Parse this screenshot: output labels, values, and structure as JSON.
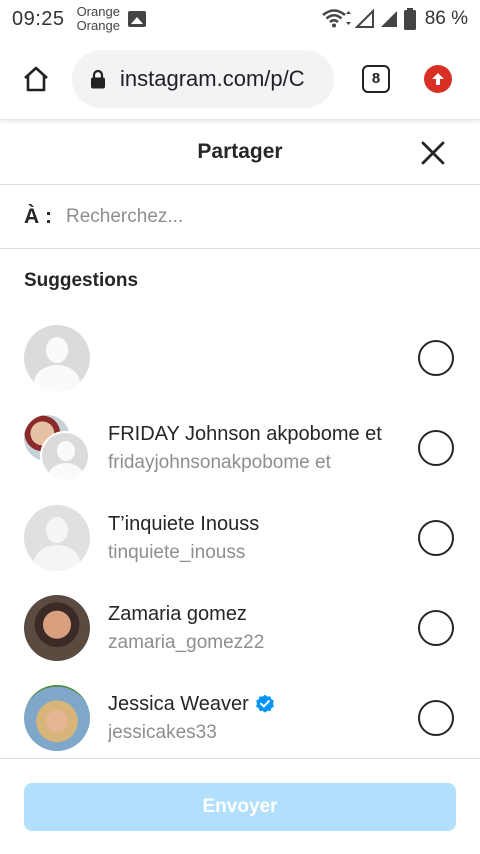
{
  "status_bar": {
    "time": "09:25",
    "carrier_line1": "Orange",
    "carrier_line2": "Orange",
    "battery_percent": "86 %",
    "battery_level": 0.86
  },
  "browser": {
    "url": "instagram.com/p/C",
    "tab_count": "8"
  },
  "share": {
    "title": "Partager",
    "to_label": "À :",
    "search_placeholder": "Recherchez...",
    "suggestions_title": "Suggestions",
    "contacts": [
      {
        "name": "",
        "handle": "",
        "verified": false
      },
      {
        "name": "FRIDAY Johnson akpobome et",
        "handle": "fridayjohnsonakpobome et",
        "verified": false
      },
      {
        "name": "T’inquiete Inouss",
        "handle": "tinquiete_inouss",
        "verified": false
      },
      {
        "name": "Zamaria gomez",
        "handle": "zamaria_gomez22",
        "verified": false
      },
      {
        "name": "Jessica Weaver",
        "handle": "jessicakes33",
        "verified": true
      }
    ],
    "send_label": "Envoyer"
  },
  "colors": {
    "accent_disabled": "#b2dffc",
    "verified_blue": "#0095f6",
    "update_red": "#d93025"
  }
}
